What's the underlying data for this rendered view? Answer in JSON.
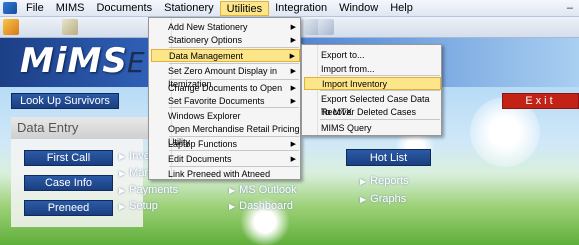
{
  "menubar": {
    "items": [
      "File",
      "MIMS",
      "Documents",
      "Stationery",
      "Utilities",
      "Integration",
      "Window",
      "Help"
    ],
    "active": "Utilities",
    "minimize_glyph": "–"
  },
  "banner": {
    "logo": "MiMS",
    "logo_rest": "E"
  },
  "buttons": {
    "look_up_survivors": "Look Up Survivors",
    "exit": "Exit",
    "first_call": "First Call",
    "case_info": "Case Info",
    "preneed": "Preneed",
    "hot_list": "Hot List"
  },
  "panel": {
    "title": "Data Entry"
  },
  "links_col1": [
    "Inve",
    "Mark",
    "Payments",
    "Setup"
  ],
  "links_col2": [
    "MS Outlook",
    "Dashboard"
  ],
  "links_col3": [
    "Reports",
    "Graphs"
  ],
  "utilities_menu": [
    {
      "label": "Add New Stationery",
      "submenu": true
    },
    {
      "label": "Stationery Options",
      "submenu": true
    },
    {
      "sep": true
    },
    {
      "label": "Data Management",
      "submenu": true,
      "highlight": true
    },
    {
      "sep": true
    },
    {
      "label": "Set Zero Amount Display in Itemization",
      "submenu": true
    },
    {
      "sep": true
    },
    {
      "label": "Change Documents to Open",
      "submenu": true
    },
    {
      "label": "Set Favorite Documents",
      "submenu": true
    },
    {
      "sep": true
    },
    {
      "label": "Windows Explorer"
    },
    {
      "label": "Open Merchandise Retail Pricing Utility"
    },
    {
      "sep": true
    },
    {
      "label": "Laptop Functions",
      "submenu": true
    },
    {
      "sep": true
    },
    {
      "label": "Edit Documents",
      "submenu": true
    },
    {
      "sep": true
    },
    {
      "label": "Link Preneed with Atneed"
    }
  ],
  "data_management_menu": [
    {
      "label": "Export to..."
    },
    {
      "label": "Import from..."
    },
    {
      "sep": true
    },
    {
      "label": "Import Inventory",
      "highlight": true
    },
    {
      "sep": true
    },
    {
      "label": "Export Selected Case Data To MTX"
    },
    {
      "label": "Recover Deleted Cases"
    },
    {
      "sep": true
    },
    {
      "label": "MIMS Query"
    }
  ],
  "colors": {
    "nav_button": "#1f4a8f",
    "exit_button": "#c32316",
    "menu_highlight": "#fde68a"
  }
}
